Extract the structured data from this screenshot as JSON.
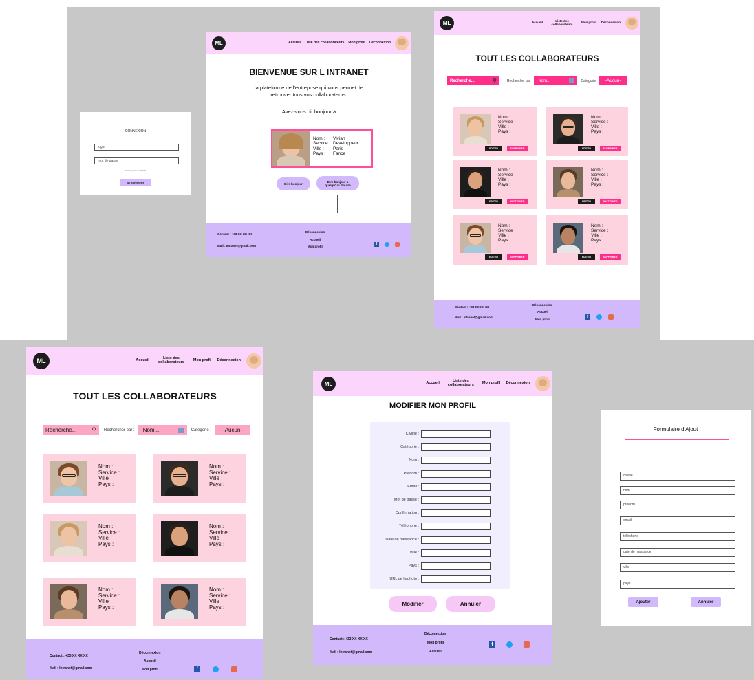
{
  "logo_text": "ML",
  "login": {
    "title": "CONNEXION",
    "login_value": "login",
    "password_value": "mot de passe",
    "forgot": "Mot de passe oublié ?",
    "submit": "Se connecter"
  },
  "home": {
    "nav": [
      "Accueil",
      "Liste des collaborateurs",
      "Mon profil",
      "Déconnexion"
    ],
    "title": "BIENVENUE SUR L INTRANET",
    "subtitle_line1": "la plateforme de l'entreprise qui vous permet  de",
    "subtitle_line2": "retrouver tous vos collaborateurs.",
    "prompt": "Avez-vous dit bonjour à",
    "profile_labels": [
      "Nom :",
      "Service :",
      "Ville :",
      "Pays :"
    ],
    "profile_values": [
      "Vivian",
      "Developpeur",
      "Paris",
      "Fance"
    ],
    "btn_hello": "Dire bonjour",
    "btn_other_line1": "Dire bonjour à",
    "btn_other_line2": "quelqu'un d'autre"
  },
  "list_small": {
    "nav": [
      "Accueil",
      "Liste des collaborateurs",
      "Mon profil",
      "Déconnexion"
    ],
    "title": "TOUT LES COLLABORATEURS",
    "search": "Recherche...",
    "search_by": "Rechercher par",
    "select_value": "Nom...",
    "category_label": "Categorie",
    "category_value": "-Aucun-",
    "card_labels": [
      "Nom :",
      "Service :",
      "Ville :",
      "Pays :"
    ],
    "edit": "EDITER",
    "delete": "SUPPRIMER"
  },
  "list_large": {
    "nav": [
      "Accueil",
      "Liste des collaborateurs",
      "Mon profil",
      "Déconnexion"
    ],
    "title": "TOUT LES COLLABORATEURS",
    "search": "Recherche...",
    "search_by": "Rechercher par :",
    "select_value": "Nom...",
    "category_label": "Categorie :",
    "category_value": "-Aucun-",
    "card_labels": [
      "Nom :",
      "Service :",
      "Ville :",
      "Pays :"
    ]
  },
  "profile": {
    "nav": [
      "Accueil",
      "Liste des collaborateurs",
      "Mon profil",
      "Déconnexion"
    ],
    "title": "MODIFIER MON PROFIL",
    "fields": [
      "Civilité :",
      "Catégorie :",
      "Nom :",
      "Prénom :",
      "Email :",
      "Mot de passe :",
      "Confirmation :",
      "Téléphone :",
      "Date de naissance :",
      "Ville :",
      "Pays :",
      "URL de la photo :"
    ],
    "btn_modify": "Modifier",
    "btn_cancel": "Annuler"
  },
  "add_form": {
    "title": "Formulaire d'Ajout",
    "fields": [
      "civilité",
      "nom",
      "prénom",
      "email",
      "téléphone",
      "date de naissance",
      "ville",
      "pays"
    ],
    "btn_add": "Ajouter",
    "btn_cancel": "Annuler"
  },
  "footer": {
    "contact": "Contact : +33 XX XX XX",
    "mail": "Mail : Intranet@gmail.com",
    "links_a": [
      "Déconnexion",
      "Accueil",
      "Mon profil"
    ],
    "links_b": [
      "Déconnexion",
      "Mon profil",
      "Accueil"
    ],
    "social_icons": [
      "facebook-icon",
      "twitter-icon",
      "instagram-icon"
    ]
  },
  "colors": {
    "header": "#fbd5fb",
    "footer": "#d2b9fb",
    "accent_pink": "#ff2e8a",
    "card_pink": "#fcd3df",
    "button_purple": "#d2b9fb"
  }
}
